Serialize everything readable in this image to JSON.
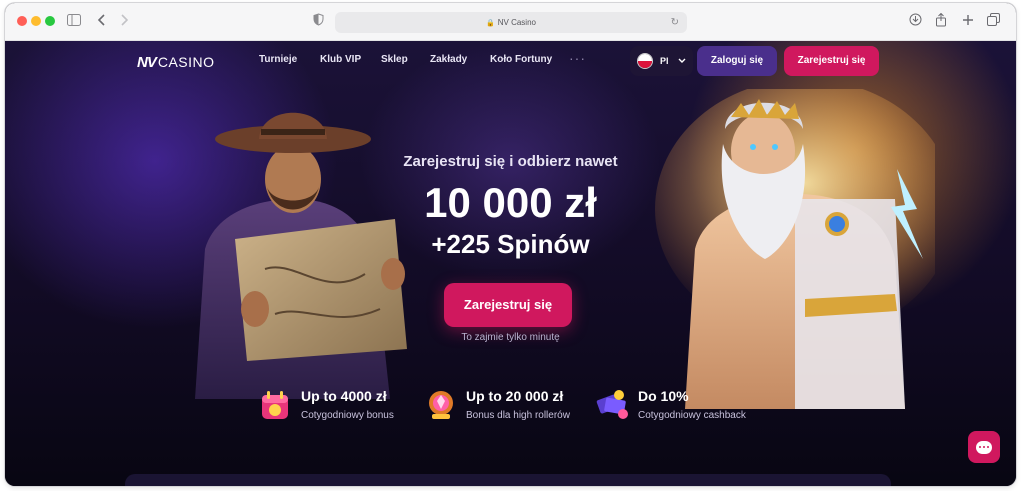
{
  "browser": {
    "url_text": "NV Casino"
  },
  "nav": {
    "logo_mark": "NV",
    "logo_text": "CASINO",
    "links": [
      "Turnieje",
      "Klub VIP",
      "Sklep",
      "Zakłady",
      "Koło Fortuny"
    ],
    "more": "···",
    "language": "Pl",
    "login_label": "Zaloguj się",
    "register_label": "Zarejestruj się"
  },
  "hero": {
    "subtitle": "Zarejestruj się i odbierz nawet",
    "amount": "10 000 zł",
    "spins": "+225 Spinów",
    "cta_label": "Zarejestruj się",
    "cta_note": "To zajmie tylko minutę"
  },
  "features": [
    {
      "title": "Up to 4000 zł",
      "desc": "Cotygodniowy bonus",
      "icon": "calendar-gift-icon"
    },
    {
      "title": "Up to 20 000 zł",
      "desc": "Bonus dla high rollerów",
      "icon": "crystal-ball-icon"
    },
    {
      "title": "Do 10%",
      "desc": "Cotygodniowy cashback",
      "icon": "cashback-cards-icon"
    }
  ],
  "colors": {
    "brand_pink": "#d0185e",
    "login_purple": "#4a2f8c",
    "page_bg": "#120b25"
  }
}
